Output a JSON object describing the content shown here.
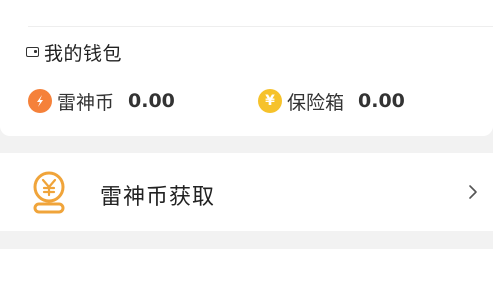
{
  "wallet": {
    "title": "我的钱包",
    "icon": "wallet-icon",
    "balances": [
      {
        "label": "雷神币",
        "value": "0.00",
        "icon": "lightning-coin-icon",
        "color": "#f5813a"
      },
      {
        "label": "保险箱",
        "value": "0.00",
        "icon": "yen-coin-icon",
        "color": "#f6c22b"
      }
    ]
  },
  "obtain": {
    "label": "雷神币获取",
    "icon": "coin-stack-icon",
    "accent": "#f0a43a"
  }
}
